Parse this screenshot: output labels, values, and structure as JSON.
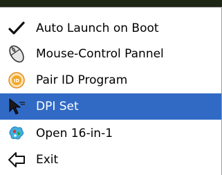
{
  "menu": {
    "items": [
      {
        "label": "Auto Launch on Boot",
        "icon": "checkmark-icon",
        "checked": true
      },
      {
        "label": "Mouse-Control Pannel",
        "icon": "mouse-icon"
      },
      {
        "label": "Pair ID Program",
        "icon": "pair-id-icon"
      },
      {
        "label": "DPI Set",
        "icon": "dpi-cursor-icon",
        "selected": true
      },
      {
        "label": "Open 16-in-1",
        "icon": "open-16-in-1-icon"
      },
      {
        "label": "Exit",
        "icon": "exit-arrow-icon"
      }
    ]
  },
  "colors": {
    "selection_bg": "#316ac5",
    "selection_text": "#ffffff",
    "text": "#000000",
    "menu_bg": "#ffffff"
  }
}
